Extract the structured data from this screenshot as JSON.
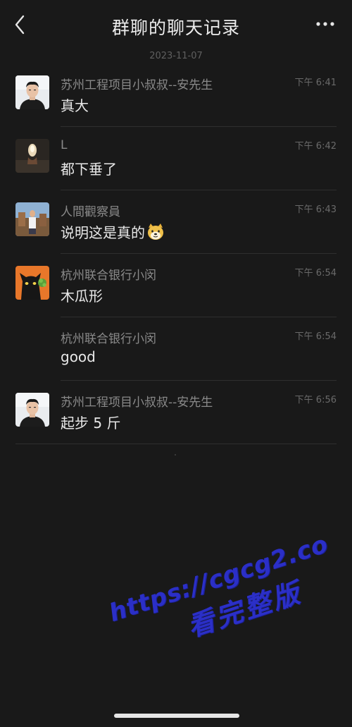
{
  "header": {
    "title": "群聊的聊天记录"
  },
  "date_label": "2023-11-07",
  "messages": [
    {
      "sender": "苏州工程项目小叔叔--安先生",
      "time": "下午 6:41",
      "text": "真大",
      "avatar": "man-avatar"
    },
    {
      "sender": "L",
      "time": "下午 6:42",
      "text": "都下垂了",
      "avatar": "dark-photo-avatar"
    },
    {
      "sender": "人間觀察員",
      "time": "下午 6:43",
      "text": "说明这是真的",
      "avatar": "outdoor-photo-avatar",
      "emoji": "doge-emoji"
    },
    {
      "sender": "杭州联合银行小闵",
      "time": "下午 6:54",
      "text": "木瓜形",
      "avatar": "black-cat-avatar"
    },
    {
      "sender": "杭州联合银行小闵",
      "time": "下午 6:54",
      "text": "good",
      "avatar": ""
    },
    {
      "sender": "苏州工程项目小叔叔--安先生",
      "time": "下午 6:56",
      "text": "起步 5 斤",
      "avatar": "man-avatar"
    }
  ],
  "watermark": {
    "url": "https://cgcg2.co",
    "text": "看完整版"
  },
  "colors": {
    "background": "#191919",
    "watermark": "#2b2fc7"
  }
}
